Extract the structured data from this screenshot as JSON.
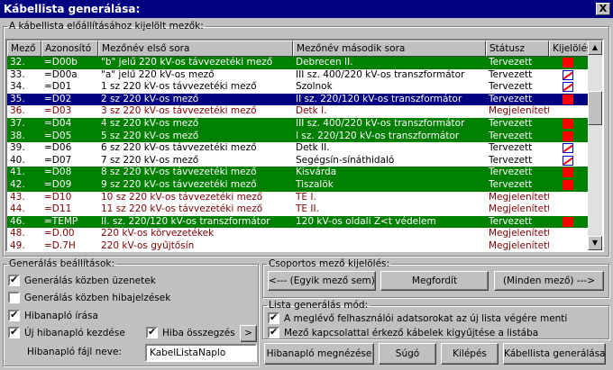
{
  "window": {
    "title": "Kábellista generálása:",
    "close_label": "X"
  },
  "fields_group": {
    "title": "A kábellista előállításához kijelölt mezők:"
  },
  "columns": [
    "Mező",
    "Azonosító",
    "Mezőnév első sora",
    "Mezőnév második sora",
    "Státusz",
    "Kijelölés"
  ],
  "rows": [
    {
      "mezo": "32.",
      "azon": "=D00b",
      "nev1": "\"b\" jelű 220 kV-os távvezetéki mező",
      "nev2": "Debrecen II.",
      "status": "Tervezett",
      "style": "green",
      "mark": "filled"
    },
    {
      "mezo": "33.",
      "azon": "=D00a",
      "nev1": "\"a\" jelű 220 kV-os mező",
      "nev2": "III sz. 400/220 kV-os transzformátor",
      "status": "Tervezett",
      "style": "white",
      "mark": "crossed"
    },
    {
      "mezo": "34.",
      "azon": "=D01",
      "nev1": "1 sz 220 kV-os távvezetéki mező",
      "nev2": "Szolnok",
      "status": "Tervezett",
      "style": "white",
      "mark": "crossed"
    },
    {
      "mezo": "35.",
      "azon": "=D02",
      "nev1": "2 sz 220 kV-os mező",
      "nev2": "II sz. 220/120 kV-os transzformátor",
      "status": "Tervezett",
      "style": "blue",
      "mark": "filled"
    },
    {
      "mezo": "36.",
      "azon": "=D03",
      "nev1": "3 sz 220 kV-os távvezetéki mező",
      "nev2": "Detk I.",
      "status": "Megjelenített",
      "style": "red",
      "mark": "none"
    },
    {
      "mezo": "37.",
      "azon": "=D04",
      "nev1": "4 sz 220 kV-os mező",
      "nev2": "III sz. 400/220 kV-os transzformátor",
      "status": "Tervezett",
      "style": "green",
      "mark": "filled"
    },
    {
      "mezo": "38.",
      "azon": "=D05",
      "nev1": "5 sz 220 kV-os mező",
      "nev2": "I sz. 220/120 kV-os transzformátor",
      "status": "Tervezett",
      "style": "green",
      "mark": "filled"
    },
    {
      "mezo": "39.",
      "azon": "=D06",
      "nev1": "6 sz 220 kV-os távvezetéki mező",
      "nev2": "Detk II.",
      "status": "Tervezett",
      "style": "white",
      "mark": "crossed"
    },
    {
      "mezo": "40.",
      "azon": "=D07",
      "nev1": "7 sz 220 kV-os mező",
      "nev2": "Segégsín-sínáthidaló",
      "status": "Tervezett",
      "style": "white",
      "mark": "crossed"
    },
    {
      "mezo": "41.",
      "azon": "=D08",
      "nev1": "8 sz 220 kV-os távvezetéki mező",
      "nev2": "Kisvárda",
      "status": "Tervezett",
      "style": "green",
      "mark": "filled"
    },
    {
      "mezo": "42.",
      "azon": "=D09",
      "nev1": "9 sz 220 kV-os távvezetéki mező",
      "nev2": "Tiszalök",
      "status": "Tervezett",
      "style": "green",
      "mark": "filled"
    },
    {
      "mezo": "43.",
      "azon": "=D10",
      "nev1": "10 sz 220 kV-os távvezetéki mező",
      "nev2": "TE I.",
      "status": "Megjelenített",
      "style": "red",
      "mark": "none"
    },
    {
      "mezo": "44.",
      "azon": "=D11",
      "nev1": "11 sz 220 kV-os távvezetéki mező",
      "nev2": "TE II.",
      "status": "Megjelenített",
      "style": "red",
      "mark": "none"
    },
    {
      "mezo": "46.",
      "azon": "=TEMP",
      "nev1": "II. sz. 220/120 kV-os transzformátor",
      "nev2": "120 kV-os oldali Z<t védelem",
      "status": "Tervezett",
      "style": "green",
      "mark": "filled"
    },
    {
      "mezo": "48.",
      "azon": "=D.00",
      "nev1": "220 kV-os körvezetékek",
      "nev2": "",
      "status": "Megjelenített",
      "style": "red",
      "mark": "none"
    },
    {
      "mezo": "49.",
      "azon": "=D.7H",
      "nev1": "220 kV-os gyűjtősín",
      "nev2": "",
      "status": "Megjelenített",
      "style": "red",
      "mark": "none"
    }
  ],
  "settings": {
    "title": "Generálás beállítások:",
    "opt_messages": "Generálás közben üzenetek",
    "opt_errors": "Generálás közben hibajelzések",
    "opt_log_write": "Hibanapló írása",
    "opt_new_log": "Új hibanapló kezdése",
    "opt_summary": "Hiba összegzés",
    "more_label": ">",
    "logfile_label": "Hibanapló fájl neve:",
    "logfile_value": "KabelListaNaplo"
  },
  "group_select": {
    "title": "Csoportos mező kijelölés:",
    "none_btn": "<--- (Egyik mező sem)",
    "invert_btn": "Megfordít",
    "all_btn": "(Minden mező) --->"
  },
  "list_mode": {
    "title": "Lista generálás mód:",
    "opt_append": "A meglévő felhasználói adatsorokat az új lista végére menti",
    "opt_collect": "Mező kapcsolattal érkező kábelek kigyűjtése a listába"
  },
  "buttons": {
    "view_log": "Hibanapló megnézése",
    "help": "Súgó",
    "exit": "Kilépés",
    "generate": "Kábellista generálása"
  }
}
